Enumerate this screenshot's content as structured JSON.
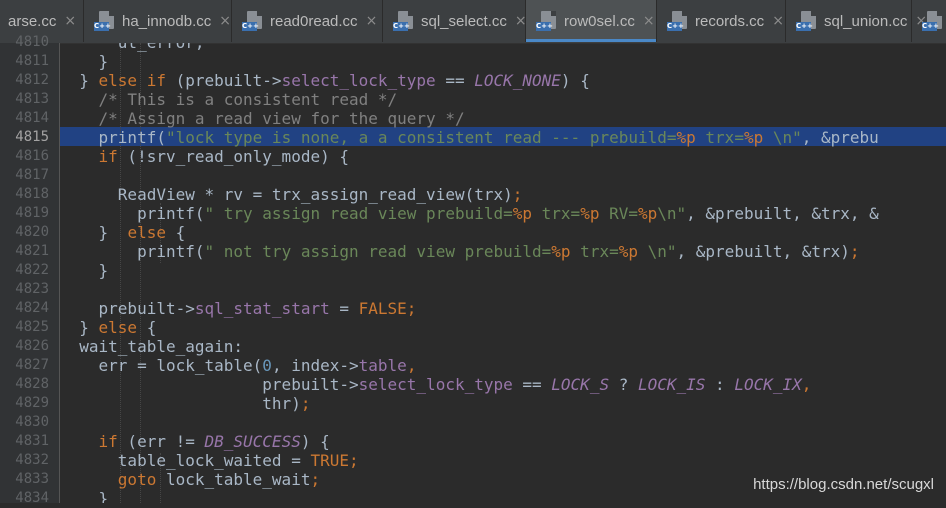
{
  "tabs": [
    {
      "name": "tab-parse",
      "label": "arse.cc",
      "icon": "cpp-file-icon",
      "has_icon": false,
      "active": false
    },
    {
      "name": "tab-ha-innodb",
      "label": "ha_innodb.cc",
      "icon": "cpp-file-icon",
      "has_icon": true,
      "active": false
    },
    {
      "name": "tab-read0read",
      "label": "read0read.cc",
      "icon": "cpp-file-icon",
      "has_icon": true,
      "active": false
    },
    {
      "name": "tab-sql-select",
      "label": "sql_select.cc",
      "icon": "cpp-file-icon",
      "has_icon": true,
      "active": false
    },
    {
      "name": "tab-row0sel",
      "label": "row0sel.cc",
      "icon": "cpp-file-icon",
      "has_icon": true,
      "active": true
    },
    {
      "name": "tab-records",
      "label": "records.cc",
      "icon": "cpp-file-icon",
      "has_icon": true,
      "active": false
    },
    {
      "name": "tab-sql-union",
      "label": "sql_union.cc",
      "icon": "cpp-file-icon",
      "has_icon": true,
      "active": false
    },
    {
      "name": "tab-overflow",
      "label": "",
      "icon": "cpp-file-icon",
      "has_icon": true,
      "active": false
    }
  ],
  "tab_close_glyph": "×",
  "file_icon_badge": "C++",
  "line_numbers": [
    "4810",
    "4811",
    "4812",
    "4813",
    "4814",
    "4815",
    "4816",
    "4817",
    "4818",
    "4819",
    "4820",
    "4821",
    "4822",
    "4823",
    "4824",
    "4825",
    "4826",
    "4827",
    "4828",
    "4829",
    "4830",
    "4831",
    "4832",
    "4833",
    "4834"
  ],
  "current_line": "4815",
  "code_lines": [
    [
      {
        "t": "      ut_error;",
        "c": ""
      }
    ],
    [
      {
        "t": "    }",
        "c": ""
      }
    ],
    [
      {
        "t": "  } ",
        "c": ""
      },
      {
        "t": "else if",
        "c": "kw"
      },
      {
        "t": " (prebuilt->",
        "c": ""
      },
      {
        "t": "select_lock_type",
        "c": "fld"
      },
      {
        "t": " == ",
        "c": ""
      },
      {
        "t": "LOCK_NONE",
        "c": "cst"
      },
      {
        "t": ") {",
        "c": ""
      }
    ],
    [
      {
        "t": "    /* This is a consistent read */",
        "c": "cmt"
      }
    ],
    [
      {
        "t": "    /* Assign a read view for the query */",
        "c": "cmt"
      }
    ],
    [
      {
        "t": "    printf(",
        "c": ""
      },
      {
        "t": "\"lock type is none, a a consistent read --- prebuild=",
        "c": "str"
      },
      {
        "t": "%p",
        "c": "fmt"
      },
      {
        "t": " trx=",
        "c": "str"
      },
      {
        "t": "%p",
        "c": "fmt"
      },
      {
        "t": " \\n\"",
        "c": "str"
      },
      {
        "t": ", &prebu",
        "c": ""
      }
    ],
    [
      {
        "t": "    ",
        "c": ""
      },
      {
        "t": "if",
        "c": "kw"
      },
      {
        "t": " (!srv_read_only_mode) {",
        "c": ""
      }
    ],
    [
      {
        "t": "",
        "c": ""
      }
    ],
    [
      {
        "t": "      ReadView * rv = trx_assign_read_view(trx)",
        "c": ""
      },
      {
        "t": ";",
        "c": "kw"
      }
    ],
    [
      {
        "t": "        printf(",
        "c": ""
      },
      {
        "t": "\" try assign read view prebuild=",
        "c": "str"
      },
      {
        "t": "%p",
        "c": "fmt"
      },
      {
        "t": " trx=",
        "c": "str"
      },
      {
        "t": "%p",
        "c": "fmt"
      },
      {
        "t": " RV=",
        "c": "str"
      },
      {
        "t": "%p",
        "c": "fmt"
      },
      {
        "t": "\\n\"",
        "c": "str"
      },
      {
        "t": ", &prebuilt, &trx, &",
        "c": ""
      }
    ],
    [
      {
        "t": "    }  ",
        "c": ""
      },
      {
        "t": "else",
        "c": "kw"
      },
      {
        "t": " {",
        "c": ""
      }
    ],
    [
      {
        "t": "        printf(",
        "c": ""
      },
      {
        "t": "\" not try assign read view prebuild=",
        "c": "str"
      },
      {
        "t": "%p",
        "c": "fmt"
      },
      {
        "t": " trx=",
        "c": "str"
      },
      {
        "t": "%p",
        "c": "fmt"
      },
      {
        "t": " \\n\"",
        "c": "str"
      },
      {
        "t": ", &prebuilt, &trx)",
        "c": ""
      },
      {
        "t": ";",
        "c": "kw"
      }
    ],
    [
      {
        "t": "    }",
        "c": ""
      }
    ],
    [
      {
        "t": "",
        "c": ""
      }
    ],
    [
      {
        "t": "    prebuilt->",
        "c": ""
      },
      {
        "t": "sql_stat_start",
        "c": "fld"
      },
      {
        "t": " = ",
        "c": ""
      },
      {
        "t": "FALSE",
        "c": "bool"
      },
      {
        "t": ";",
        "c": "kw"
      }
    ],
    [
      {
        "t": "  } ",
        "c": ""
      },
      {
        "t": "else",
        "c": "kw"
      },
      {
        "t": " {",
        "c": ""
      }
    ],
    [
      {
        "t": "  wait_table_again:",
        "c": ""
      }
    ],
    [
      {
        "t": "    err = lock_table(",
        "c": ""
      },
      {
        "t": "0",
        "c": "num"
      },
      {
        "t": ", index->",
        "c": ""
      },
      {
        "t": "table",
        "c": "fld"
      },
      {
        "t": ",",
        "c": "kw"
      }
    ],
    [
      {
        "t": "                     prebuilt->",
        "c": ""
      },
      {
        "t": "select_lock_type",
        "c": "fld"
      },
      {
        "t": " == ",
        "c": ""
      },
      {
        "t": "LOCK_S",
        "c": "cst"
      },
      {
        "t": " ? ",
        "c": ""
      },
      {
        "t": "LOCK_IS",
        "c": "cst"
      },
      {
        "t": " : ",
        "c": ""
      },
      {
        "t": "LOCK_IX",
        "c": "cst"
      },
      {
        "t": ",",
        "c": "kw"
      }
    ],
    [
      {
        "t": "                     thr)",
        "c": ""
      },
      {
        "t": ";",
        "c": "kw"
      }
    ],
    [
      {
        "t": "",
        "c": ""
      }
    ],
    [
      {
        "t": "    ",
        "c": ""
      },
      {
        "t": "if",
        "c": "kw"
      },
      {
        "t": " (err != ",
        "c": ""
      },
      {
        "t": "DB_SUCCESS",
        "c": "cst"
      },
      {
        "t": ") {",
        "c": ""
      }
    ],
    [
      {
        "t": "      table_lock_waited = ",
        "c": ""
      },
      {
        "t": "TRUE",
        "c": "bool"
      },
      {
        "t": ";",
        "c": "kw"
      }
    ],
    [
      {
        "t": "      ",
        "c": ""
      },
      {
        "t": "goto",
        "c": "kw"
      },
      {
        "t": " lock_table_wait",
        "c": ""
      },
      {
        "t": ";",
        "c": "kw"
      }
    ],
    [
      {
        "t": "    }",
        "c": ""
      }
    ]
  ],
  "watermark": "https://blog.csdn.net/scugxl",
  "colors": {
    "background": "#2b2b2b",
    "gutter": "#313335",
    "current_line_highlight": "#214283",
    "keyword": "#cc7832",
    "string": "#6a8759",
    "comment": "#808080",
    "field": "#9876aa",
    "number": "#6897bb",
    "tab_underline": "#4a88c7"
  }
}
